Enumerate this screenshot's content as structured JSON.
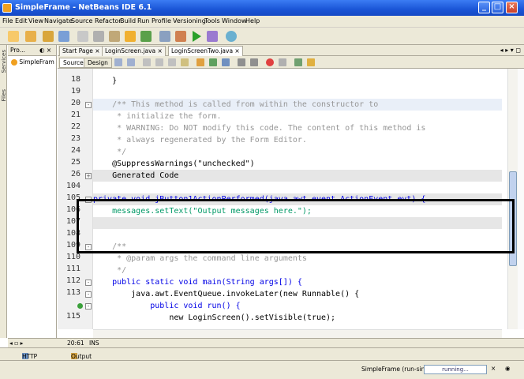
{
  "window": {
    "title": "SimpleFrame - NetBeans IDE 6.1"
  },
  "menu": [
    "File",
    "Edit",
    "View",
    "Navigate",
    "Source",
    "Refactor",
    "Build",
    "Run",
    "Profile",
    "Versioning",
    "Tools",
    "Window",
    "Help"
  ],
  "left_tabs": {
    "services": "Services",
    "files": "Files"
  },
  "projects": {
    "header": "Pro...",
    "node": "SimpleFram"
  },
  "doc_tabs": [
    "Start Page",
    "LoginScreen.java",
    "LoginScreenTwo.java"
  ],
  "editor_tabs": {
    "source": "Source",
    "design": "Design"
  },
  "code_lines": [
    {
      "num": "18",
      "text": "    }"
    },
    {
      "num": "19",
      "text": ""
    },
    {
      "num": "20",
      "text": "    /** This method is called from within the constructor to"
    },
    {
      "num": "21",
      "text": "     * initialize the form."
    },
    {
      "num": "22",
      "text": "     * WARNING: Do NOT modify this code. The content of this method is"
    },
    {
      "num": "23",
      "text": "     * always regenerated by the Form Editor."
    },
    {
      "num": "24",
      "text": "     */"
    },
    {
      "num": "25",
      "text": "    @SuppressWarnings(\"unchecked\")"
    },
    {
      "num": "26",
      "text": "    Generated Code"
    },
    {
      "num": "104",
      "text": ""
    },
    {
      "num": "105",
      "text": "private void jButton1ActionPerformed(java.awt.event.ActionEvent evt) {"
    },
    {
      "num": "106",
      "text": "    messages.setText(\"Output messages here.\");"
    },
    {
      "num": "107",
      "text": ""
    },
    {
      "num": "108",
      "text": ""
    },
    {
      "num": "109",
      "text": "    /**"
    },
    {
      "num": "110",
      "text": "     * @param args the command line arguments"
    },
    {
      "num": "111",
      "text": "     */"
    },
    {
      "num": "112",
      "text": "    public static void main(String args[]) {"
    },
    {
      "num": "113",
      "text": "        java.awt.EventQueue.invokeLater(new Runnable() {"
    },
    {
      "num": "",
      "text": "            public void run() {"
    },
    {
      "num": "115",
      "text": "                new LoginScreen().setVisible(true);"
    }
  ],
  "position": {
    "caret": "20:61",
    "mode": "INS"
  },
  "bottom_tabs": [
    "HTTP Monitor",
    "Output"
  ],
  "status": {
    "task": "SimpleFrame (run-single)",
    "progress_label": "running..."
  }
}
